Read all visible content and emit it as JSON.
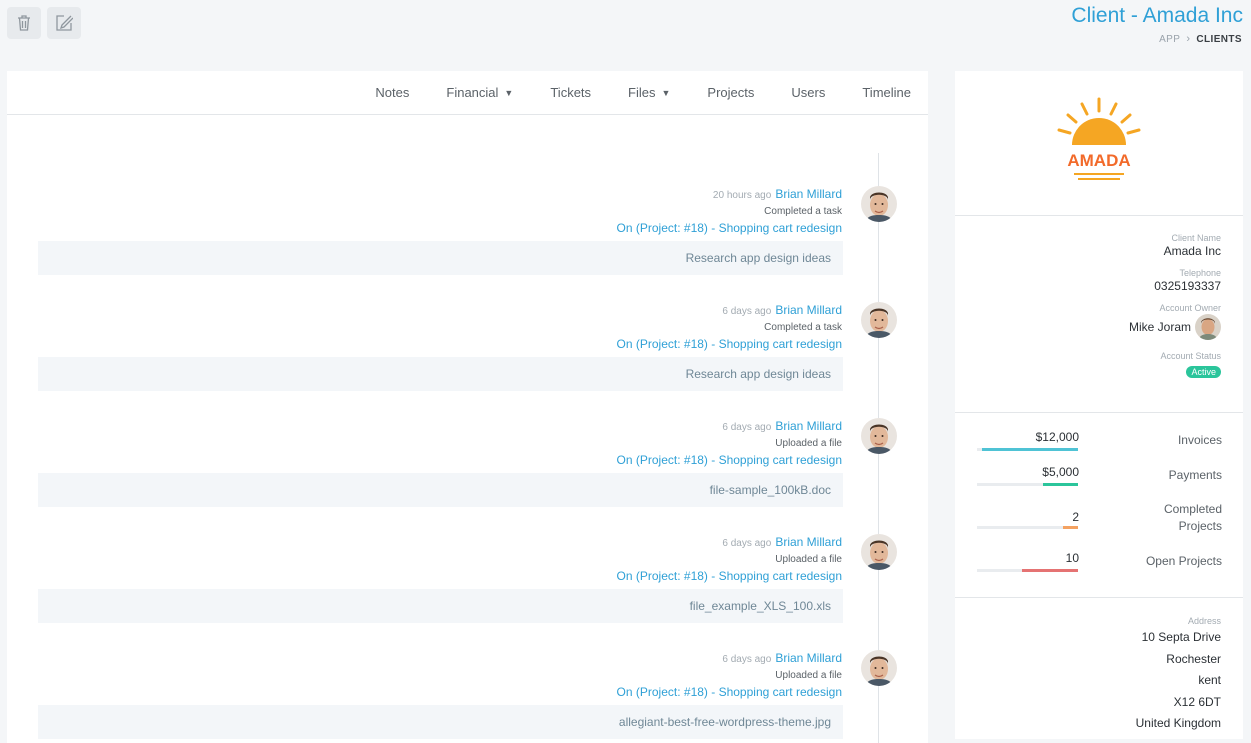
{
  "header": {
    "title": "Client - Amada Inc",
    "breadcrumb": {
      "app": "APP",
      "current": "CLIENTS"
    },
    "buttons": {
      "delete_icon": "trash-icon",
      "edit_icon": "edit-icon"
    }
  },
  "tabs": [
    {
      "label": "Timeline",
      "has_caret": false
    },
    {
      "label": "Users",
      "has_caret": false
    },
    {
      "label": "Projects",
      "has_caret": false
    },
    {
      "label": "Files",
      "has_caret": true
    },
    {
      "label": "Tickets",
      "has_caret": false
    },
    {
      "label": "Financial",
      "has_caret": true
    },
    {
      "label": "Notes",
      "has_caret": false
    }
  ],
  "timeline": [
    {
      "user": "Brian Millard",
      "when": "20 hours ago",
      "action": "Completed a task",
      "project": "On (Project: #18) - Shopping cart redesign",
      "detail": "Research app design ideas"
    },
    {
      "user": "Brian Millard",
      "when": "6 days ago",
      "action": "Completed a task",
      "project": "On (Project: #18) - Shopping cart redesign",
      "detail": "Research app design ideas"
    },
    {
      "user": "Brian Millard",
      "when": "6 days ago",
      "action": "Uploaded a file",
      "project": "On (Project: #18) - Shopping cart redesign",
      "detail": "file-sample_100kB.doc"
    },
    {
      "user": "Brian Millard",
      "when": "6 days ago",
      "action": "Uploaded a file",
      "project": "On (Project: #18) - Shopping cart redesign",
      "detail": "file_example_XLS_100.xls"
    },
    {
      "user": "Brian Millard",
      "when": "6 days ago",
      "action": "Uploaded a file",
      "project": "On (Project: #18) - Shopping cart redesign",
      "detail": "allegiant-best-free-wordpress-theme.jpg"
    }
  ],
  "client": {
    "logo_text": "AMADA",
    "brand_color": "#f5a623",
    "name_label": "Client Name",
    "name": "Amada Inc",
    "phone_label": "Telephone",
    "phone": "0325193337",
    "owner_label": "Account Owner",
    "owner": "Mike Joram",
    "status_label": "Account Status",
    "status": "Active",
    "status_color": "#2bc59b"
  },
  "stats": [
    {
      "label": "Invoices",
      "value": "$12,000",
      "fill": 0.95,
      "color": "#4fc3d5"
    },
    {
      "label": "Payments",
      "value": "$5,000",
      "fill": 0.35,
      "color": "#2bc59b"
    },
    {
      "label": "Completed Projects",
      "value": "2",
      "fill": 0.15,
      "color": "#f4a261"
    },
    {
      "label": "Open Projects",
      "value": "10",
      "fill": 0.55,
      "color": "#e57373"
    }
  ],
  "address": {
    "label": "Address",
    "lines": [
      "10 Septa Drive",
      "Rochester",
      "kent",
      "X12 6DT",
      "United Kingdom"
    ]
  }
}
